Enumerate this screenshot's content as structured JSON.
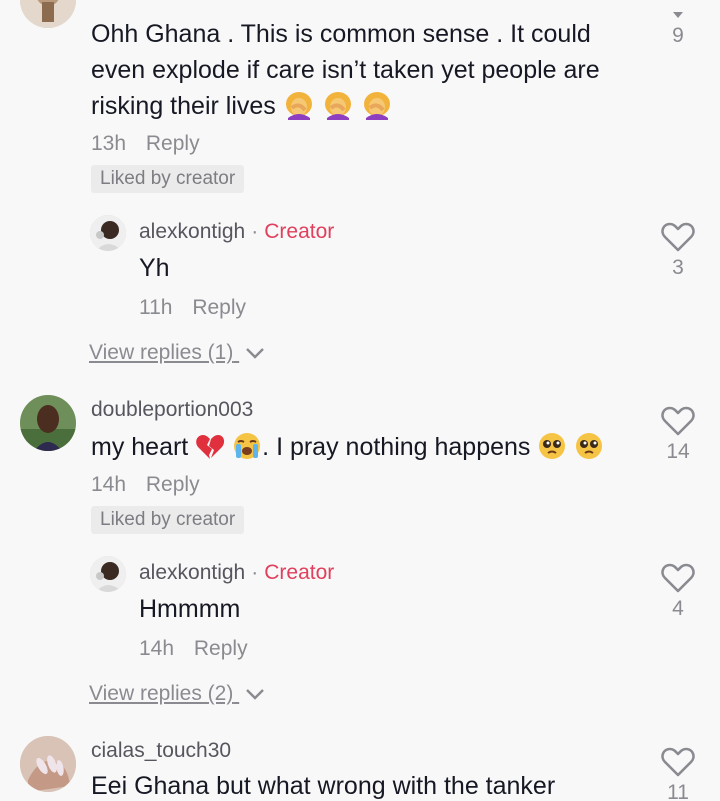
{
  "comments": [
    {
      "text_before": "Ohh Ghana . This is common sense . It could even explode if care isn’t taken yet people are risking their lives",
      "time": "13h",
      "reply_label": "Reply",
      "liked_label": "Liked by creator",
      "likes": "9",
      "reply": {
        "username": "alexkontigh",
        "creator_label": "Creator",
        "text": "Yh",
        "time": "11h",
        "reply_label": "Reply",
        "likes": "3"
      },
      "view_replies": "View replies (1)"
    },
    {
      "username": "doubleportion003",
      "text_a": "my heart",
      "text_b": ". I pray nothing happens",
      "time": "14h",
      "reply_label": "Reply",
      "liked_label": "Liked by creator",
      "likes": "14",
      "reply": {
        "username": "alexkontigh",
        "creator_label": "Creator",
        "text": "Hmmmm",
        "time": "14h",
        "reply_label": "Reply",
        "likes": "4"
      },
      "view_replies": "View replies (2)"
    },
    {
      "username": "cialas_touch30",
      "text": "Eei Ghana but what wrong with the tanker",
      "likes": "11"
    }
  ],
  "colors": {
    "creator": "#e0405e",
    "muted": "#8a8b91",
    "text": "#161823",
    "background": "#f8f8f8"
  }
}
